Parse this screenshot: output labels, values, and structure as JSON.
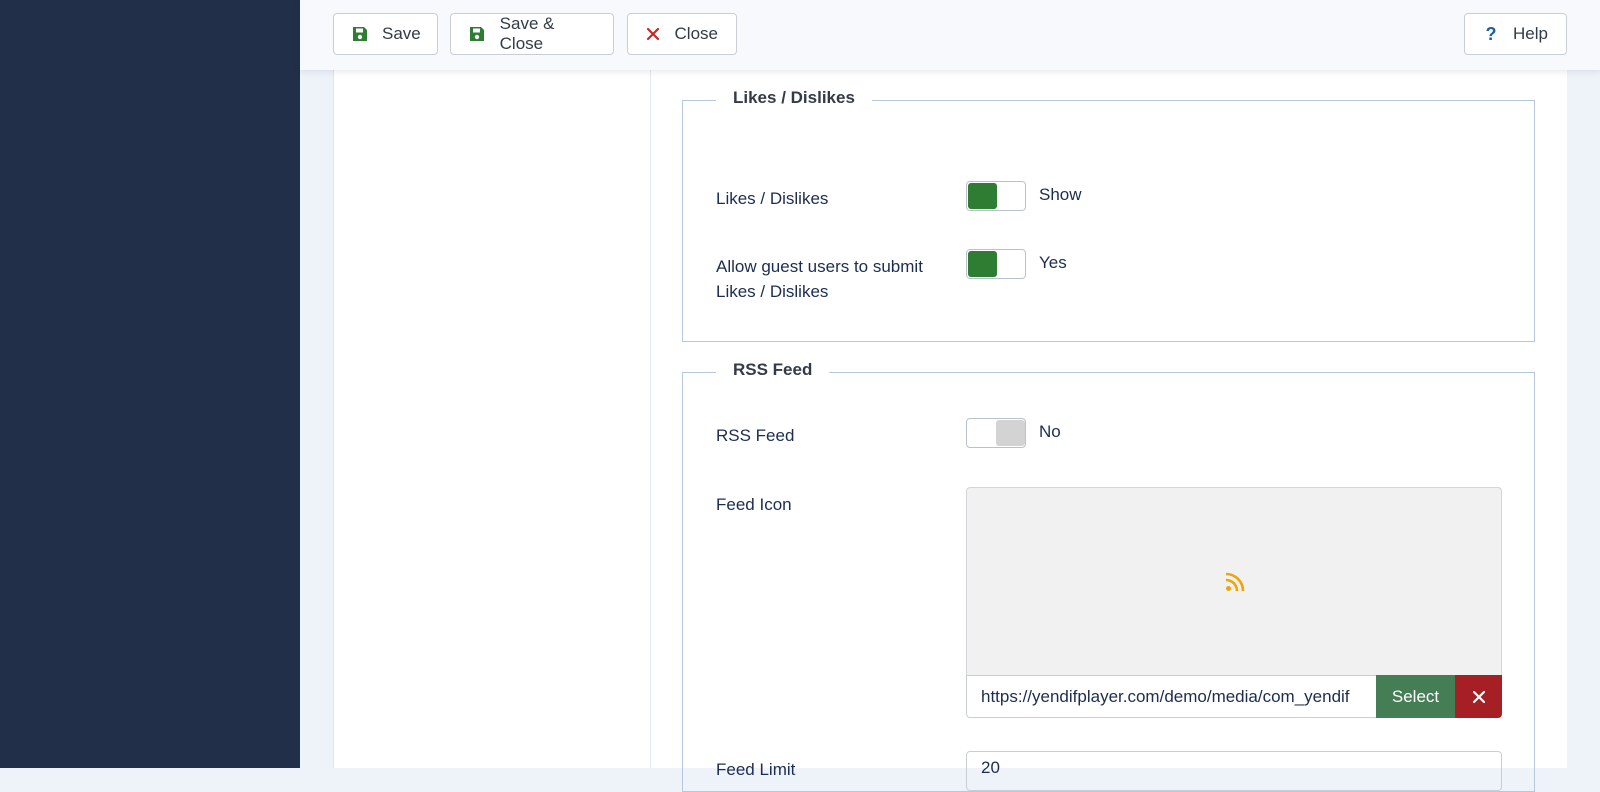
{
  "toolbar": {
    "save_label": "Save",
    "save_close_label": "Save & Close",
    "close_label": "Close",
    "help_label": "Help"
  },
  "likes_section": {
    "legend": "Likes / Dislikes",
    "fields": [
      {
        "label": "Likes / Dislikes",
        "value": "Show",
        "enabled": true
      },
      {
        "label_line1": "Allow guest users to submit",
        "label_line2": "Likes / Dislikes",
        "value": "Yes",
        "enabled": true
      }
    ]
  },
  "rss_section": {
    "legend": "RSS Feed",
    "rss_feed": {
      "label": "RSS Feed",
      "value": "No",
      "enabled": false
    },
    "feed_icon": {
      "label": "Feed Icon",
      "icon": "rss-icon",
      "url": "https://yendifplayer.com/demo/media/com_yendif",
      "select_label": "Select"
    },
    "feed_limit": {
      "label": "Feed Limit",
      "value": "20"
    }
  },
  "colors": {
    "sidebar": "#212f48",
    "toggle_on": "#2e7d32",
    "select_button": "#457d54",
    "clear_button": "#a51f24",
    "rss_icon": "#f0a30a",
    "close_icon": "#c62828"
  }
}
